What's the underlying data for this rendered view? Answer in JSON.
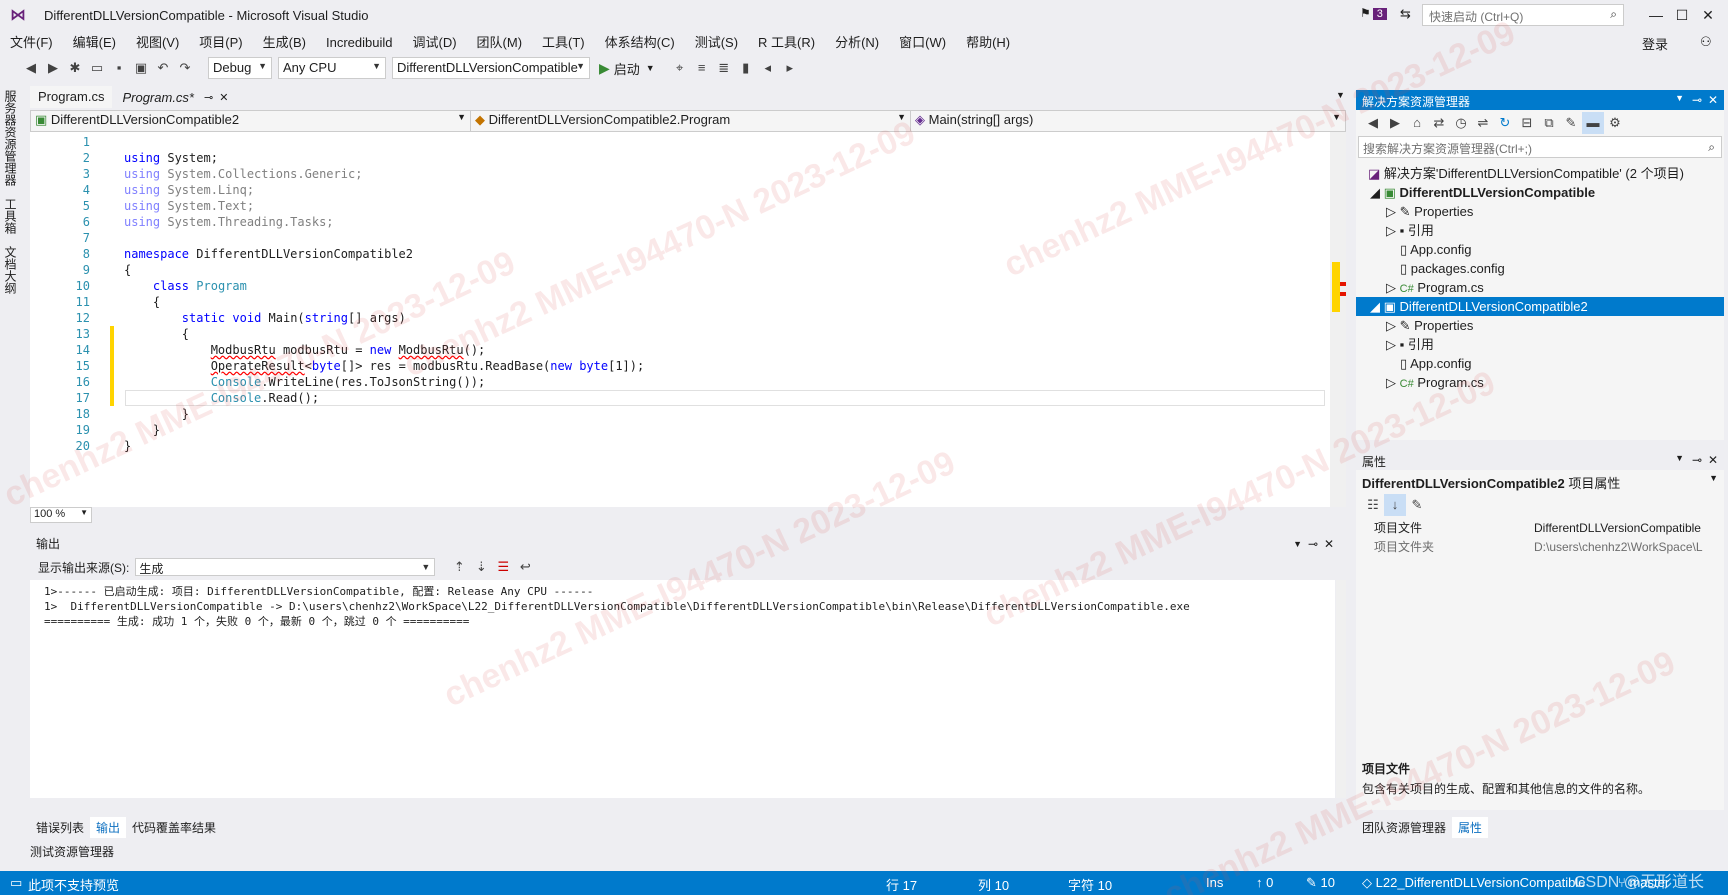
{
  "window": {
    "title": "DifferentDLLVersionCompatible - Microsoft Visual Studio",
    "notif_count": "3",
    "quick_launch_placeholder": "快速启动 (Ctrl+Q)",
    "login": "登录"
  },
  "menu": [
    "文件(F)",
    "编辑(E)",
    "视图(V)",
    "项目(P)",
    "生成(B)",
    "Incredibuild",
    "调试(D)",
    "团队(M)",
    "工具(T)",
    "体系结构(C)",
    "测试(S)",
    "R 工具(R)",
    "分析(N)",
    "窗口(W)",
    "帮助(H)"
  ],
  "toolbar": {
    "config": "Debug",
    "platform": "Any CPU",
    "startup_project": "DifferentDLLVersionCompatible",
    "start_label": "启动"
  },
  "left_tabs": [
    "服务器资源管理器",
    "工具箱",
    "文档大纲"
  ],
  "doc_tabs": [
    {
      "label": "Program.cs"
    },
    {
      "label": "Program.cs*"
    }
  ],
  "navbar": {
    "project": "DifferentDLLVersionCompatible2",
    "class": "DifferentDLLVersionCompatible2.Program",
    "member": "Main(string[] args)"
  },
  "editor": {
    "zoom": "100 %",
    "lines": [
      [
        "1",
        "using System;"
      ],
      [
        "2",
        "using System.Collections.Generic;"
      ],
      [
        "3",
        "using System.Linq;"
      ],
      [
        "4",
        "using System.Text;"
      ],
      [
        "5",
        "using System.Threading.Tasks;"
      ],
      [
        "6",
        ""
      ],
      [
        "7",
        "namespace DifferentDLLVersionCompatible2"
      ],
      [
        "8",
        "{"
      ],
      [
        "9",
        "    class Program"
      ],
      [
        "10",
        "    {"
      ],
      [
        "11",
        "        static void Main(string[] args)"
      ],
      [
        "12",
        "        {"
      ],
      [
        "13",
        "            ModbusRtu modbusRtu = new ModbusRtu();"
      ],
      [
        "14",
        "            OperateResult<byte[]> res = modbusRtu.ReadBase(new byte[1]);"
      ],
      [
        "15",
        "            Console.WriteLine(res.ToJsonString());"
      ],
      [
        "16",
        "            Console.Read();"
      ],
      [
        "17",
        "        }"
      ],
      [
        "18",
        "    }"
      ],
      [
        "19",
        "}"
      ],
      [
        "20",
        ""
      ]
    ]
  },
  "output": {
    "title": "输出",
    "source_label": "显示输出来源(S):",
    "source_value": "生成",
    "lines": [
      "1>------ 已启动生成: 项目: DifferentDLLVersionCompatible, 配置: Release Any CPU ------",
      "1>  DifferentDLLVersionCompatible -> D:\\users\\chenhz2\\WorkSpace\\L22_DifferentDLLVersionCompatible\\DifferentDLLVersionCompatible\\bin\\Release\\DifferentDLLVersionCompatible.exe",
      "========== 生成: 成功 1 个，失败 0 个，最新 0 个，跳过 0 个 =========="
    ]
  },
  "bottom_tabs": [
    "错误列表",
    "输出",
    "代码覆盖率结果"
  ],
  "test_explorer": "测试资源管理器",
  "solution_explorer": {
    "title": "解决方案资源管理器",
    "search_placeholder": "搜索解决方案资源管理器(Ctrl+;)",
    "items": [
      {
        "label": "解决方案'DifferentDLLVersionCompatible' (2 个项目)",
        "indent": 0
      },
      {
        "label": "DifferentDLLVersionCompatible",
        "indent": 1
      },
      {
        "label": "Properties",
        "indent": 2
      },
      {
        "label": "引用",
        "indent": 2
      },
      {
        "label": "App.config",
        "indent": 2
      },
      {
        "label": "packages.config",
        "indent": 2
      },
      {
        "label": "Program.cs",
        "indent": 2
      },
      {
        "label": "DifferentDLLVersionCompatible2",
        "indent": 1
      },
      {
        "label": "Properties",
        "indent": 2
      },
      {
        "label": "引用",
        "indent": 2
      },
      {
        "label": "App.config",
        "indent": 2
      },
      {
        "label": "Program.cs",
        "indent": 2
      }
    ]
  },
  "properties": {
    "title": "属性",
    "object": "DifferentDLLVersionCompatible2",
    "object_type": "项目属性",
    "rows": [
      [
        "项目文件",
        "DifferentDLLVersionCompatible"
      ],
      [
        "项目文件夹",
        "D:\\users\\chenhz2\\WorkSpace\\L"
      ]
    ],
    "desc_title": "项目文件",
    "desc_text": "包含有关项目的生成、配置和其他信息的文件的名称。"
  },
  "right_bottom_tabs": [
    "团队资源管理器",
    "属性"
  ],
  "status": {
    "message": "此项不支持预览",
    "line": "行 17",
    "col": "列 10",
    "char": "字符 10",
    "mode": "Ins",
    "up": "0",
    "edits": "10",
    "repo": "L22_DifferentDLLVersionCompatible",
    "branch": "master"
  },
  "watermark": "chenhz2 MME-I94470-N 2023-12-09",
  "csdn_mark": "CSDN @无形道长",
  "colors": {
    "accent": "#007acc",
    "vs_purple": "#68217a",
    "keyword": "#0000ff",
    "type": "#2b91af"
  }
}
